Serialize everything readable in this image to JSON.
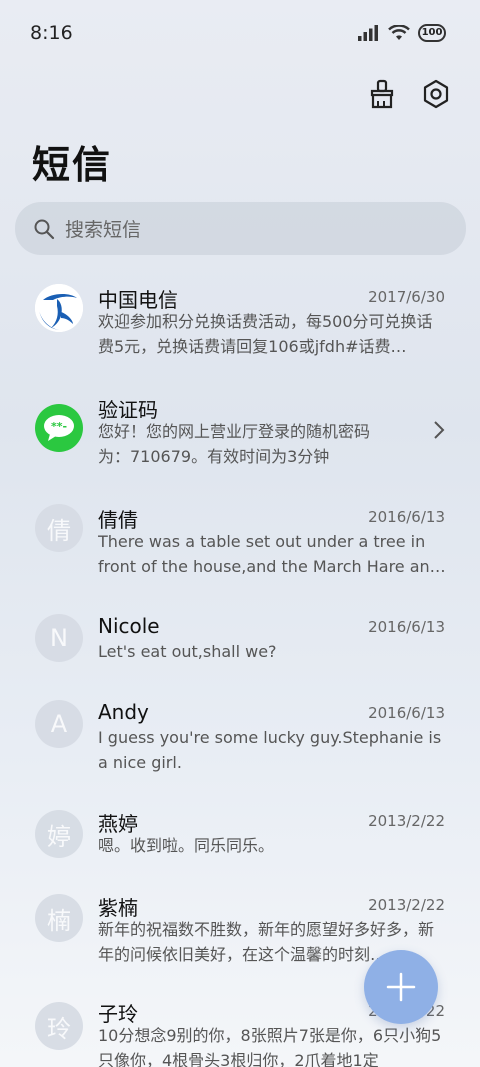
{
  "status": {
    "time": "8:16",
    "battery": "100"
  },
  "header": {
    "title": "短信"
  },
  "search": {
    "placeholder": "搜索短信"
  },
  "conversations": [
    {
      "name": "中国电信",
      "date": "2017/6/30",
      "preview": "欢迎参加积分兑换话费活动，每500分可兑换话费5元，兑换话费请回复106或jfdh#话费…",
      "avatar": "telecom-logo"
    },
    {
      "name": "验证码",
      "date": "",
      "preview": "您好！您的网上营业厅登录的随机密码为：710679。有效时间为3分钟",
      "avatar": "message-bubble"
    },
    {
      "name": "倩倩",
      "date": "2016/6/13",
      "preview": "There was a table set out under a tree in front of the house,and the March Hare an…",
      "avatar_letter": "倩"
    },
    {
      "name": "Nicole",
      "date": "2016/6/13",
      "preview": "Let's eat out,shall we?",
      "avatar_letter": "N"
    },
    {
      "name": "Andy",
      "date": "2016/6/13",
      "preview": "I guess you're some lucky guy.Stephanie is a nice girl.",
      "avatar_letter": "A"
    },
    {
      "name": "燕婷",
      "date": "2013/2/22",
      "preview": "嗯。收到啦。同乐同乐。",
      "avatar_letter": "婷"
    },
    {
      "name": "紫楠",
      "date": "2013/2/22",
      "preview": "新年的祝福数不胜数，新年的愿望好多好多，新年的问候依旧美好，在这个温馨的时刻…",
      "avatar_letter": "楠"
    },
    {
      "name": "子玲",
      "date": "2013/2/22",
      "preview": "10分想念9别的你，8张照片7张是你，6只小狗5只像你，4根骨头3根归你，2爪着地1定",
      "avatar_letter": "玲"
    }
  ],
  "colors": {
    "accent": "#8fb0e6",
    "telecom_blue": "#1a5fb4",
    "wechat_green": "#2bc840"
  }
}
